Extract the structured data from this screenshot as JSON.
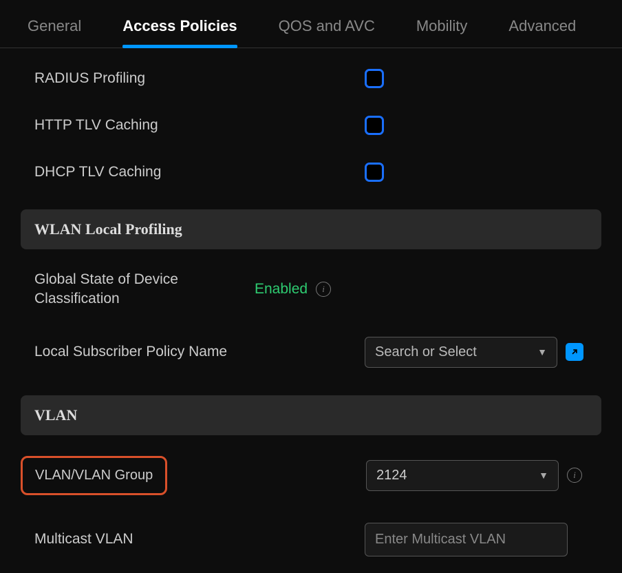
{
  "tabs": {
    "general": "General",
    "access_policies": "Access Policies",
    "qos_avc": "QOS and AVC",
    "mobility": "Mobility",
    "advanced": "Advanced"
  },
  "fields": {
    "radius_profiling": "RADIUS Profiling",
    "http_tlv_caching": "HTTP TLV Caching",
    "dhcp_tlv_caching": "DHCP TLV Caching"
  },
  "sections": {
    "wlan_local_profiling": "WLAN Local Profiling",
    "vlan": "VLAN"
  },
  "wlan": {
    "global_state_label": "Global State of Device Classification",
    "global_state_value": "Enabled",
    "local_subscriber_label": "Local Subscriber Policy Name",
    "local_subscriber_placeholder": "Search or Select"
  },
  "vlan": {
    "group_label": "VLAN/VLAN Group",
    "group_value": "2124",
    "multicast_label": "Multicast VLAN",
    "multicast_placeholder": "Enter Multicast VLAN"
  }
}
